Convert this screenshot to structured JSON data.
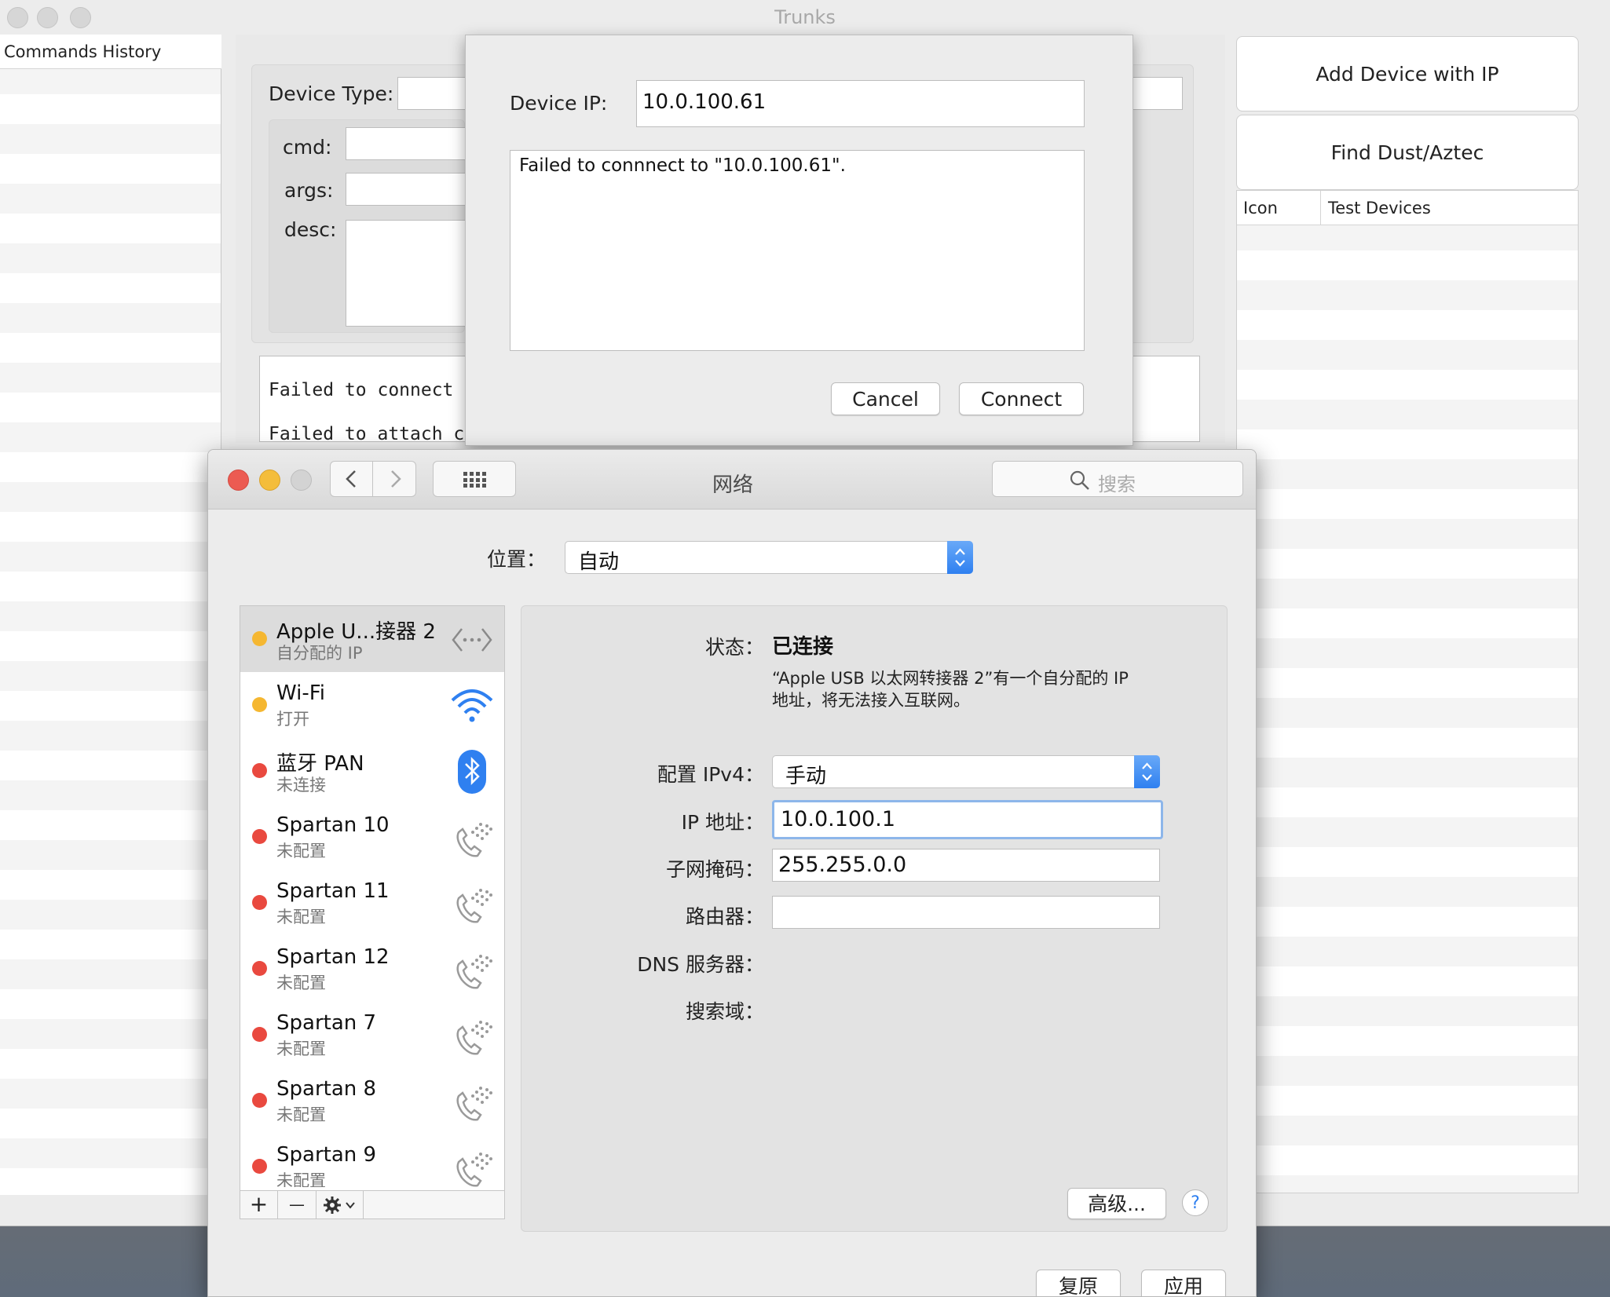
{
  "trunks": {
    "title": "Trunks",
    "history_header": "Commands History",
    "device_type_label": "Device Type:",
    "cmd_label": "cmd:",
    "args_label": "args:",
    "desc_label": "desc:",
    "log_lines": [
      "Failed to connect",
      "Failed to attach c"
    ],
    "add_device_button": "Add Device with IP",
    "find_dust_button": "Find Dust/Aztec",
    "device_columns": [
      "Icon",
      "Test Devices"
    ]
  },
  "sheet": {
    "device_ip_label": "Device IP:",
    "device_ip_value": "10.0.100.61",
    "message": "Failed to connnect to \"10.0.100.61\".",
    "cancel_button": "Cancel",
    "connect_button": "Connect"
  },
  "network": {
    "title": "网络",
    "search_placeholder": "搜索",
    "location_label": "位置：",
    "location_value": "自动",
    "services": [
      {
        "name": "Apple U...接器 2",
        "status": "自分配的 IP",
        "color": "#f5b731",
        "icon": "ethernet-icon"
      },
      {
        "name": "Wi-Fi",
        "status": "打开",
        "color": "#f5b731",
        "icon": "wifi-icon"
      },
      {
        "name": "蓝牙 PAN",
        "status": "未连接",
        "color": "#e9493f",
        "icon": "bluetooth-icon"
      },
      {
        "name": "Spartan 10",
        "status": "未配置",
        "color": "#e9493f",
        "icon": "phone-icon"
      },
      {
        "name": "Spartan 11",
        "status": "未配置",
        "color": "#e9493f",
        "icon": "phone-icon"
      },
      {
        "name": "Spartan 12",
        "status": "未配置",
        "color": "#e9493f",
        "icon": "phone-icon"
      },
      {
        "name": "Spartan 7",
        "status": "未配置",
        "color": "#e9493f",
        "icon": "phone-icon"
      },
      {
        "name": "Spartan 8",
        "status": "未配置",
        "color": "#e9493f",
        "icon": "phone-icon"
      },
      {
        "name": "Spartan 9",
        "status": "未配置",
        "color": "#e9493f",
        "icon": "phone-icon"
      }
    ],
    "status_label": "状态：",
    "status_value": "已连接",
    "status_desc_1": "“Apple USB 以太网转接器 2”有一个自分配的 IP",
    "status_desc_2": "地址，将无法接入互联网。",
    "ipv4_label": "配置 IPv4：",
    "ipv4_value": "手动",
    "ip_label": "IP 地址：",
    "ip_value": "10.0.100.1",
    "subnet_label": "子网掩码：",
    "subnet_value": "255.255.0.0",
    "router_label": "路由器：",
    "router_value": "",
    "dns_label": "DNS 服务器：",
    "search_domain_label": "搜索域：",
    "advanced_button": "高级...",
    "help_button": "?",
    "revert_button": "复原",
    "apply_button": "应用",
    "add_symbol": "+",
    "remove_symbol": "—"
  }
}
